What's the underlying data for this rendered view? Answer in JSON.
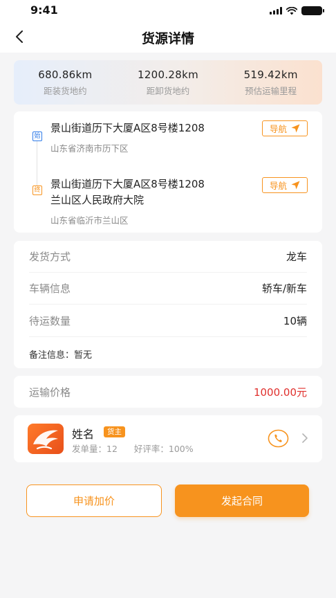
{
  "status_bar": {
    "time": "9:41"
  },
  "nav": {
    "title": "货源详情"
  },
  "stats": [
    {
      "value": "680.86km",
      "label": "距装货地约"
    },
    {
      "value": "1200.28km",
      "label": "距卸货地约"
    },
    {
      "value": "519.42km",
      "label": "预估运输里程"
    }
  ],
  "route": {
    "start": {
      "tag": "始",
      "address_line1": "景山街道历下大厦A区8号楼1208",
      "region": "山东省济南市历下区",
      "nav_label": "导航"
    },
    "end": {
      "tag": "终",
      "address_line1": "景山街道历下大厦A区8号楼1208",
      "address_line2": "兰山区人民政府大院",
      "region": "山东省临沂市兰山区",
      "nav_label": "导航"
    }
  },
  "info": {
    "rows": [
      {
        "label": "发货方式",
        "value": "龙车"
      },
      {
        "label": "车辆信息",
        "value": "轿车/新车"
      },
      {
        "label": "待运数量",
        "value": "10辆"
      }
    ],
    "remark": "备注信息：暂无"
  },
  "price": {
    "label": "运输价格",
    "value": "1000.00元"
  },
  "owner": {
    "name": "姓名",
    "badge": "货主",
    "orders": "发单量：12",
    "rating": "好评率：100%"
  },
  "actions": {
    "raise_price": "申请加价",
    "start_contract": "发起合同"
  },
  "colors": {
    "accent": "#f7931e",
    "price": "#e0302d",
    "start_tag": "#2f7be8"
  }
}
